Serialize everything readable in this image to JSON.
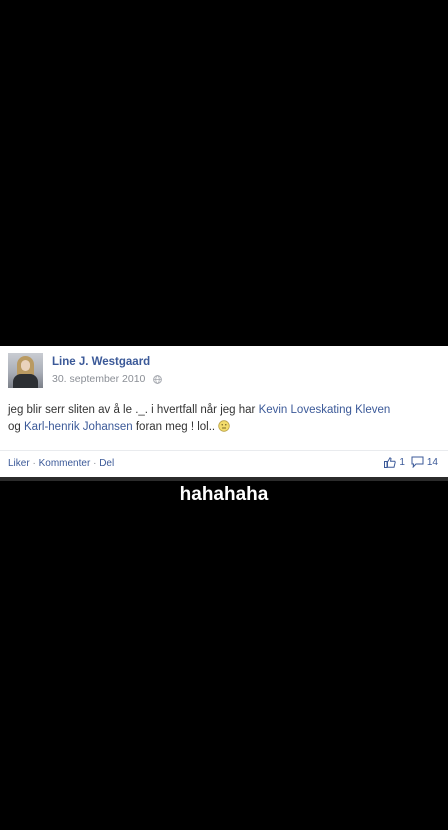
{
  "post": {
    "author": "Line J. Westgaard",
    "date": "30. september 2010",
    "audience_icon": "globe-icon",
    "message": {
      "part1": "jeg blir serr sliten av å le ._. i hvertfall når jeg har ",
      "link1": "Kevin Loveskating Kleven",
      "part2": "og ",
      "link2": "Karl-henrik Johansen",
      "part3": " foran meg ! lol.. ",
      "emoji_icon": "smiley-emoji-icon"
    },
    "actions": {
      "like": "Liker",
      "comment": "Kommenter",
      "share": "Del",
      "separator": "·"
    },
    "counts": {
      "likes": "1",
      "comments": "14",
      "like_icon": "thumbs-up-icon",
      "comment_icon": "comment-bubble-icon"
    },
    "colors": {
      "link": "#3b5998",
      "meta": "#8b8f96",
      "text": "#333333",
      "background": "#000000"
    }
  },
  "caption": "hahahaha"
}
